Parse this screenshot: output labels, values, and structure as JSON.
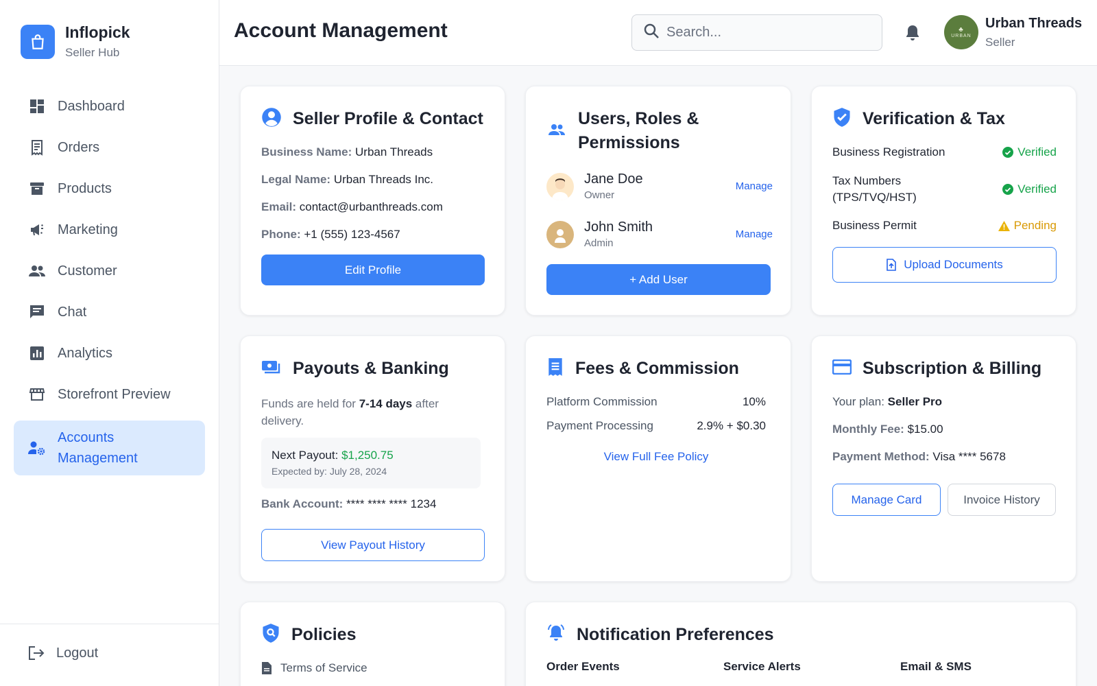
{
  "brand": {
    "name": "Inflopick",
    "subtitle": "Seller Hub"
  },
  "sidebar": {
    "items": [
      {
        "label": "Dashboard",
        "icon": "dashboard-icon"
      },
      {
        "label": "Orders",
        "icon": "receipt-icon"
      },
      {
        "label": "Products",
        "icon": "archive-box-icon"
      },
      {
        "label": "Marketing",
        "icon": "megaphone-icon"
      },
      {
        "label": "Customer",
        "icon": "people-icon"
      },
      {
        "label": "Chat",
        "icon": "chat-icon"
      },
      {
        "label": "Analytics",
        "icon": "bar-chart-icon"
      },
      {
        "label": "Storefront Preview",
        "icon": "storefront-icon"
      },
      {
        "label": "Accounts Management",
        "icon": "user-gear-icon",
        "active": true
      }
    ],
    "logout_label": "Logout"
  },
  "header": {
    "title": "Account Management",
    "search_placeholder": "Search...",
    "user": {
      "name": "Urban Threads",
      "role": "Seller",
      "avatar_text": "URBAN"
    }
  },
  "profile": {
    "title": "Seller Profile & Contact",
    "business_name_label": "Business Name:",
    "business_name": "Urban Threads",
    "legal_name_label": "Legal Name:",
    "legal_name": "Urban Threads Inc.",
    "email_label": "Email:",
    "email": "contact@urbanthreads.com",
    "phone_label": "Phone:",
    "phone": "+1 (555) 123-4567",
    "edit_button": "Edit Profile"
  },
  "users": {
    "title": "Users, Roles & Permissions",
    "list": [
      {
        "name": "Jane Doe",
        "role": "Owner",
        "action": "Manage"
      },
      {
        "name": "John Smith",
        "role": "Admin",
        "action": "Manage"
      }
    ],
    "add_button": "+ Add User"
  },
  "verification": {
    "title": "Verification & Tax",
    "items": [
      {
        "label": "Business Registration",
        "status": "Verified"
      },
      {
        "label": "Tax Numbers (TPS/TVQ/HST)",
        "status": "Verified"
      },
      {
        "label": "Business Permit",
        "status": "Pending"
      }
    ],
    "upload_button": "Upload Documents"
  },
  "payouts": {
    "title": "Payouts & Banking",
    "hold_prefix": "Funds are held for ",
    "hold_days": "7-14 days",
    "hold_suffix": " after delivery.",
    "next_payout_label": "Next Payout: ",
    "next_payout_amount": "$1,250.75",
    "expected": "Expected by: July 28, 2024",
    "bank_label": "Bank Account:",
    "bank_value": "**** **** **** 1234",
    "history_button": "View Payout History"
  },
  "fees": {
    "title": "Fees & Commission",
    "rows": [
      {
        "label": "Platform Commission",
        "value": "10%"
      },
      {
        "label": "Payment Processing",
        "value": "2.9% + $0.30"
      }
    ],
    "policy_link": "View Full Fee Policy"
  },
  "subscription": {
    "title": "Subscription & Billing",
    "plan_label": "Your plan: ",
    "plan_value": "Seller Pro",
    "fee_label": "Monthly Fee:",
    "fee_value": "$15.00",
    "method_label": "Payment Method:",
    "method_value": "Visa **** 5678",
    "manage_button": "Manage Card",
    "invoice_button": "Invoice History"
  },
  "policies": {
    "title": "Policies",
    "items": [
      "Terms of Service"
    ]
  },
  "notifications": {
    "title": "Notification Preferences",
    "columns": [
      "Order Events",
      "Service Alerts",
      "Email & SMS"
    ]
  },
  "colors": {
    "accent": "#3b82f6",
    "verified": "#16a34a",
    "pending": "#d99a06",
    "money": "#16a34a"
  }
}
